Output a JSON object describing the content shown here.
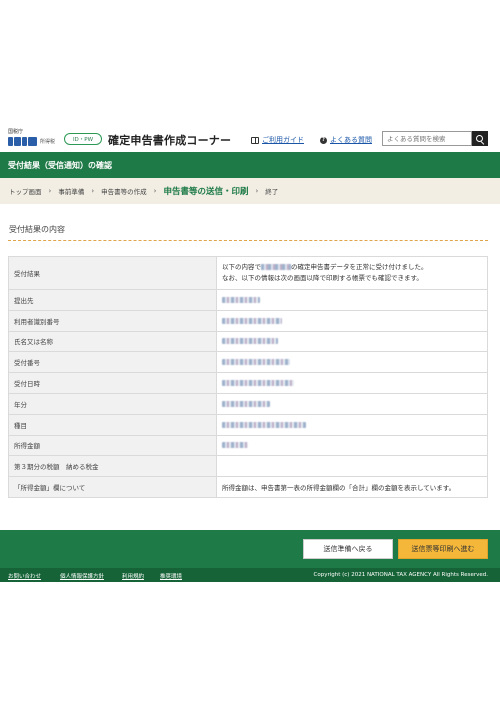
{
  "header": {
    "agency_small": "国税庁",
    "agency_kanji": "所得税",
    "idpw_label": "ID・PW",
    "site_title": "確定申告書作成コーナー",
    "guide_link": "ご利用ガイド",
    "faq_link": "よくある質問",
    "search_placeholder": "よくある質問を検索"
  },
  "page": {
    "title": "受付結果（受信通知）の確認"
  },
  "breadcrumb": {
    "items": [
      "トップ画面",
      "事前準備",
      "申告書等の作成",
      "申告書等の送信・印刷",
      "終了"
    ],
    "current_index": 3
  },
  "section": {
    "title": "受付結果の内容"
  },
  "table": {
    "rows": [
      {
        "label": "受付結果",
        "line1_pre": "以下の内容で",
        "line1_post": "の確定申告書データを正常に受け付けました。",
        "line2": "なお、以下の情報は次の画面以降で印刷する帳票でも確認できます。"
      },
      {
        "label": "提出先"
      },
      {
        "label": "利用者識別番号"
      },
      {
        "label": "氏名又は名称"
      },
      {
        "label": "受付番号"
      },
      {
        "label": "受付日時"
      },
      {
        "label": "年分"
      },
      {
        "label": "種目"
      },
      {
        "label": "所得金額"
      },
      {
        "label": "第３期分の税額　納める税金",
        "value": ""
      },
      {
        "label": "「所得金額」欄について",
        "value": "所得金額は、申告書第一表の所得金額欄の「合計」欄の金額を表示しています。"
      }
    ]
  },
  "buttons": {
    "back": "送信準備へ戻る",
    "next": "送信票等印刷へ進む"
  },
  "footer": {
    "links": [
      "お問い合わせ",
      "個人情報保護方針",
      "利用規約",
      "推奨環境"
    ],
    "copyright": "Copyright (c) 2021 NATIONAL TAX AGENCY All Rights Reserved."
  },
  "colors": {
    "primary_green": "#1e7a47",
    "footer_green": "#166337",
    "accent_orange": "#f4b73a",
    "breadcrumb_bg": "#f2eee4",
    "link_blue": "#1a55a8"
  }
}
